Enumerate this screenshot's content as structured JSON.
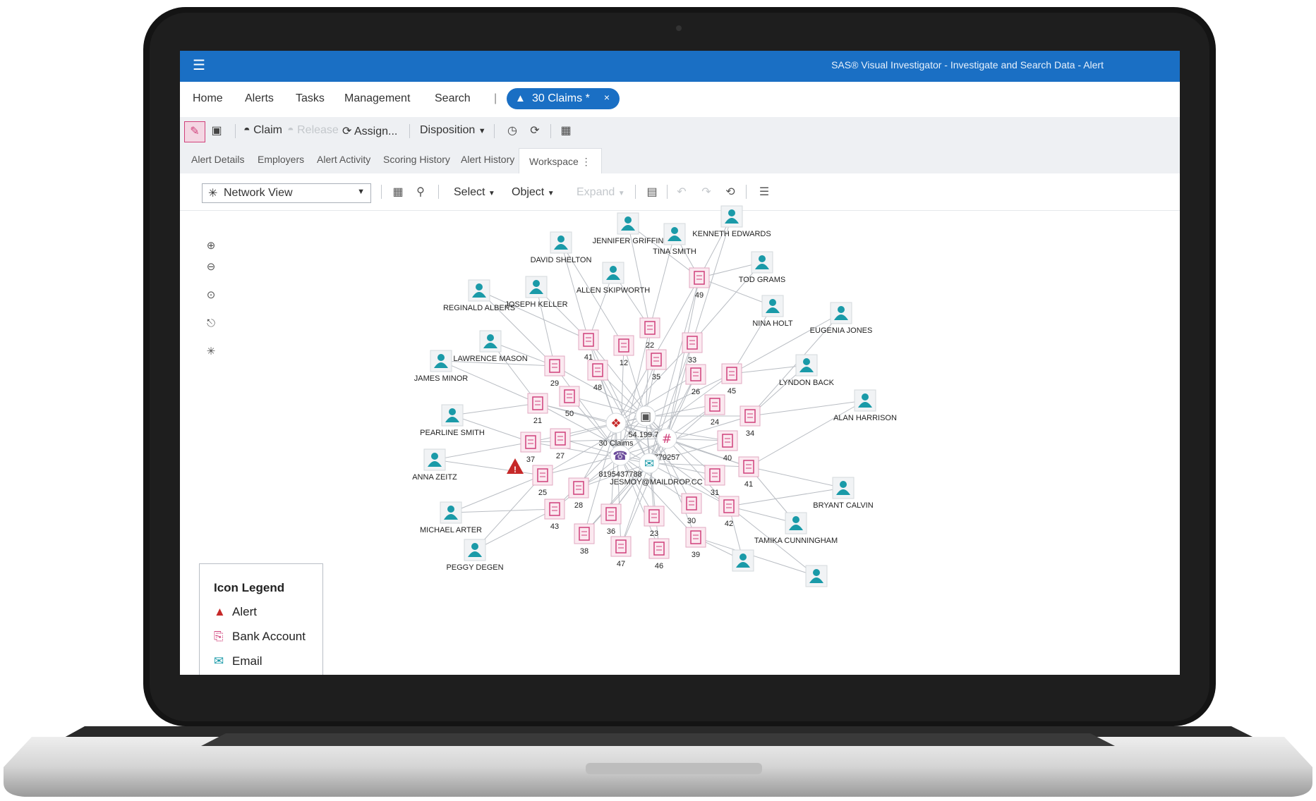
{
  "app": {
    "title": "SAS® Visual Investigator - Investigate and Search Data - Alert"
  },
  "nav": {
    "items": [
      "Home",
      "Alerts",
      "Tasks",
      "Management",
      "Search"
    ],
    "active_tab": {
      "label": "30 Claims *",
      "close": "×"
    }
  },
  "toolbar": {
    "claim": "Claim",
    "release": "Release",
    "assign": "Assign...",
    "disposition": "Disposition"
  },
  "tabs": [
    "Alert Details",
    "Employers",
    "Alert Activity",
    "Scoring History",
    "Alert History",
    "Workspace"
  ],
  "viewbar": {
    "view": "Network View",
    "select": "Select",
    "object": "Object",
    "expand": "Expand"
  },
  "legend": {
    "title": "Icon Legend",
    "items": [
      {
        "label": "Alert",
        "icon": "warning-icon"
      },
      {
        "label": "Bank Account",
        "icon": "bank-account-icon"
      },
      {
        "label": "Email",
        "icon": "email-icon"
      }
    ]
  },
  "colors": {
    "accent": "#1a6fc4",
    "person": "#1a9aa8",
    "document": "#d0407a",
    "alert": "#c62828"
  },
  "graph": {
    "center": {
      "label": "30 Claims"
    },
    "hub_labels": {
      "ip": "54.199.75",
      "account": "779257",
      "phone": "8195437788",
      "email": "JESMOY@MAILDROP.CC"
    },
    "people": [
      "JENNIFER GRIFFIN",
      "TINA SMITH",
      "KENNETH EDWARDS",
      "DAVID SHELTON",
      "ALLEN SKIPWORTH",
      "TOD GRAMS",
      "REGINALD ALBERS",
      "JOSEPH KELLER",
      "NINA HOLT",
      "EUGENIA JONES",
      "LAWRENCE MASON",
      "JAMES MINOR",
      "LYNDON BACK",
      "ALAN HARRISON",
      "PEARLINE SMITH",
      "ANNA ZEITZ",
      "BRYANT CALVIN",
      "MICHAEL ARTER",
      "TAMIKA CUNNINGHAM",
      "PEGGY DEGEN",
      "",
      ""
    ],
    "claims": [
      "49",
      "22",
      "41",
      "12",
      "33",
      "29",
      "48",
      "35",
      "26",
      "45",
      "21",
      "50",
      "24",
      "34",
      "37",
      "27",
      "40",
      "25",
      "41",
      "31",
      "28",
      "30",
      "42",
      "43",
      "36",
      "23",
      "38",
      "39",
      "47",
      "46"
    ]
  }
}
